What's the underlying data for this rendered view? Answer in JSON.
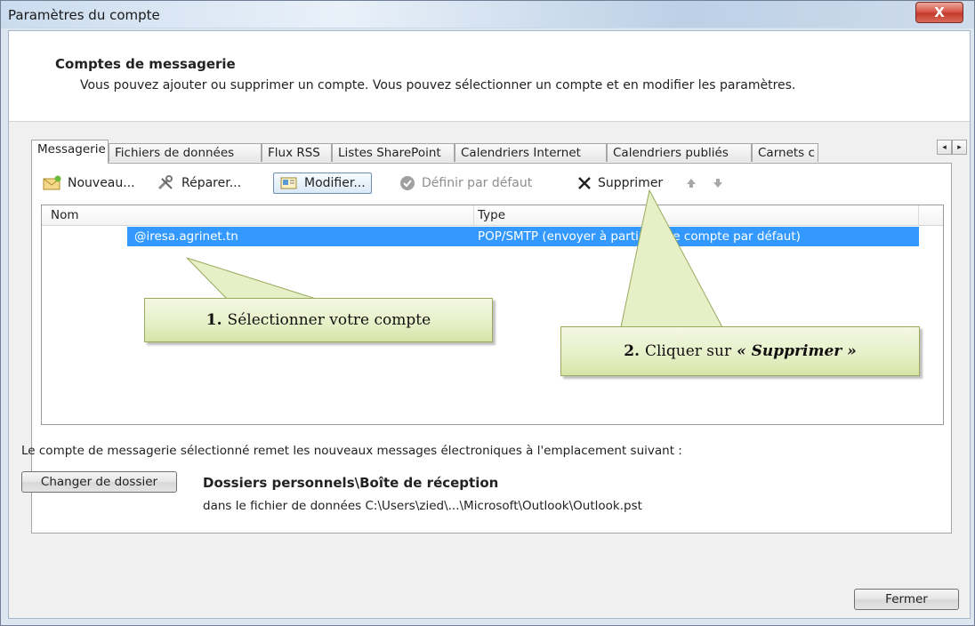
{
  "window": {
    "title": "Paramètres du compte",
    "close_label": "X"
  },
  "header": {
    "title": "Comptes de messagerie",
    "subtitle": "Vous pouvez ajouter ou supprimer un compte. Vous pouvez sélectionner un compte et en modifier les paramètres."
  },
  "tabs": {
    "items": [
      {
        "label": "Messagerie",
        "active": true
      },
      {
        "label": "Fichiers de données",
        "active": false
      },
      {
        "label": "Flux RSS",
        "active": false
      },
      {
        "label": "Listes SharePoint",
        "active": false
      },
      {
        "label": "Calendriers Internet",
        "active": false
      },
      {
        "label": "Calendriers publiés",
        "active": false
      },
      {
        "label": "Carnets c",
        "active": false
      }
    ],
    "scroll_left": "◂",
    "scroll_right": "▸"
  },
  "toolbar": {
    "new_label": "Nouveau...",
    "repair_label": "Réparer...",
    "modify_label": "Modifier...",
    "set_default_label": "Définir par défaut",
    "delete_label": "Supprimer",
    "up_icon": "arrow-up-icon",
    "down_icon": "arrow-down-icon"
  },
  "account_list": {
    "columns": {
      "name": "Nom",
      "type": "Type"
    },
    "rows": [
      {
        "name": "@iresa.agrinet.tn",
        "type": "POP/SMTP (envoyer à partir de ce compte par défaut)",
        "selected": true
      }
    ]
  },
  "delivery": {
    "info_text": "Le compte de messagerie sélectionné remet les nouveaux messages électroniques à l'emplacement suivant :",
    "change_folder_label": "Changer de dossier",
    "folder_title": "Dossiers personnels\\Boîte de réception",
    "folder_path": "dans le fichier de données C:\\Users\\zied\\...\\Microsoft\\Outlook\\Outlook.pst"
  },
  "footer": {
    "close_button_label": "Fermer"
  },
  "callouts": {
    "step1_number": "1.",
    "step1_text": "Sélectionner votre compte",
    "step2_number": "2.",
    "step2_text": "Cliquer sur",
    "step2_emphasis": "« Supprimer »"
  },
  "colors": {
    "selection": "#3399ff",
    "callout_fill": "#e6efc6",
    "close_button": "#c23a2b"
  }
}
